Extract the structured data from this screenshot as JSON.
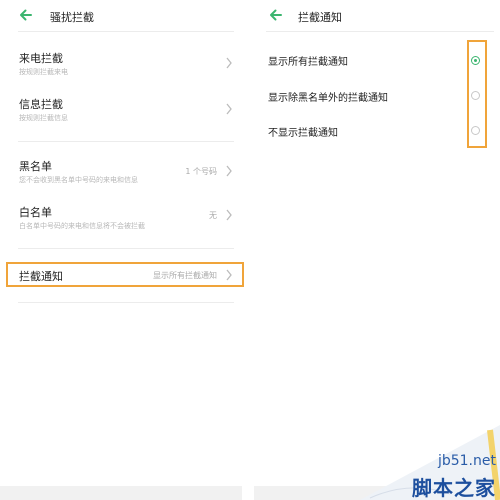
{
  "colors": {
    "accent_green": "#3bb56f",
    "highlight_orange": "#f0a43a",
    "divider": "#ececec",
    "subtext": "#b7b7b7"
  },
  "left_panel": {
    "back_icon": "arrow-left-icon",
    "title": "骚扰拦截",
    "items": [
      {
        "title": "来电拦截",
        "subtitle": "按规则拦截来电",
        "value": ""
      },
      {
        "title": "信息拦截",
        "subtitle": "按规则拦截信息",
        "value": ""
      },
      {
        "title": "黑名单",
        "subtitle": "您不会收到黑名单中号码的来电和信息",
        "value": "1 个号码"
      },
      {
        "title": "白名单",
        "subtitle": "白名单中号码的来电和信息将不会被拦截",
        "value": "无"
      },
      {
        "title": "拦截通知",
        "subtitle": "",
        "value": "显示所有拦截通知"
      }
    ]
  },
  "right_panel": {
    "back_icon": "arrow-left-icon",
    "title": "拦截通知",
    "options": [
      {
        "label": "显示所有拦截通知",
        "selected": true
      },
      {
        "label": "显示除黑名单外的拦截通知",
        "selected": false
      },
      {
        "label": "不显示拦截通知",
        "selected": false
      }
    ]
  },
  "watermark": {
    "site": "jb51.net",
    "name": "脚本之家"
  }
}
